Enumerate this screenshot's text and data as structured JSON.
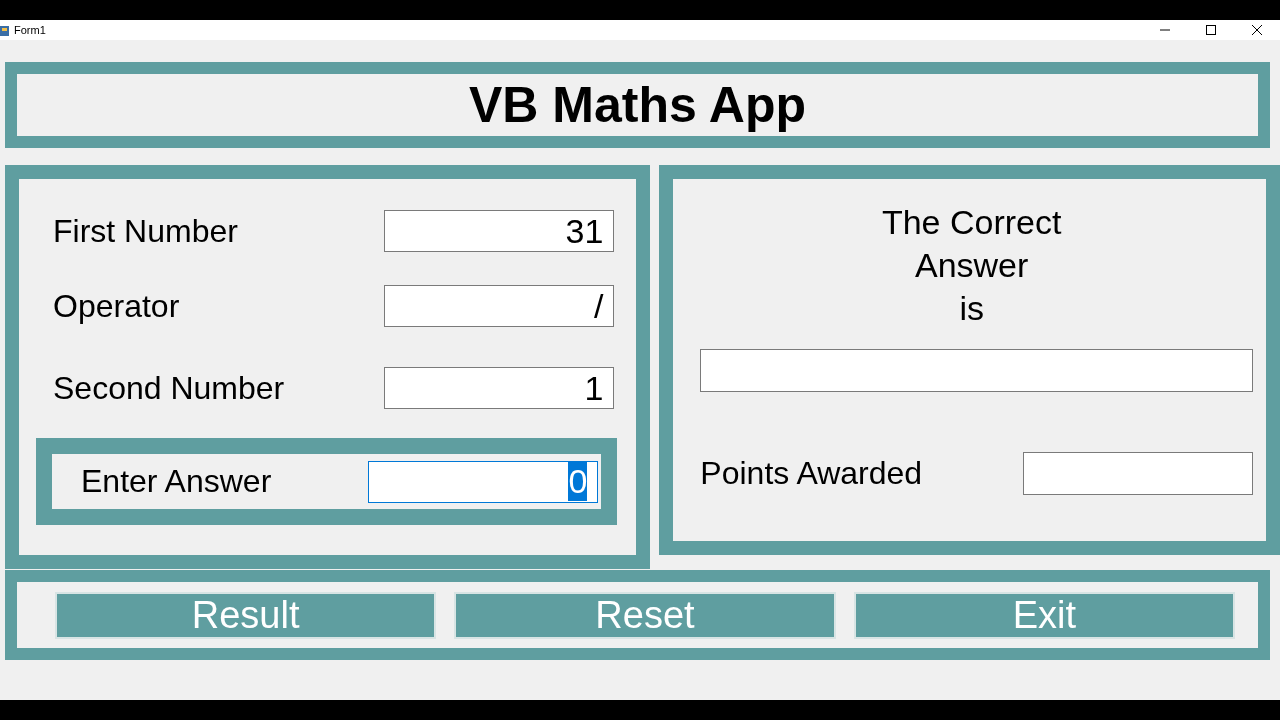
{
  "window": {
    "title": "Form1"
  },
  "header": {
    "title": "VB Maths App"
  },
  "inputs": [
    {
      "label": "First Number",
      "value": "31"
    },
    {
      "label": "Operator",
      "value": "/"
    },
    {
      "label": "Second Number",
      "value": "1"
    }
  ],
  "answer_entry": {
    "label": "Enter Answer",
    "value": "0",
    "focused": true
  },
  "result_panel": {
    "heading": [
      "The Correct",
      "Answer",
      "is"
    ],
    "points_label": "Points Awarded"
  },
  "buttons": [
    "Result",
    "Reset",
    "Exit"
  ]
}
